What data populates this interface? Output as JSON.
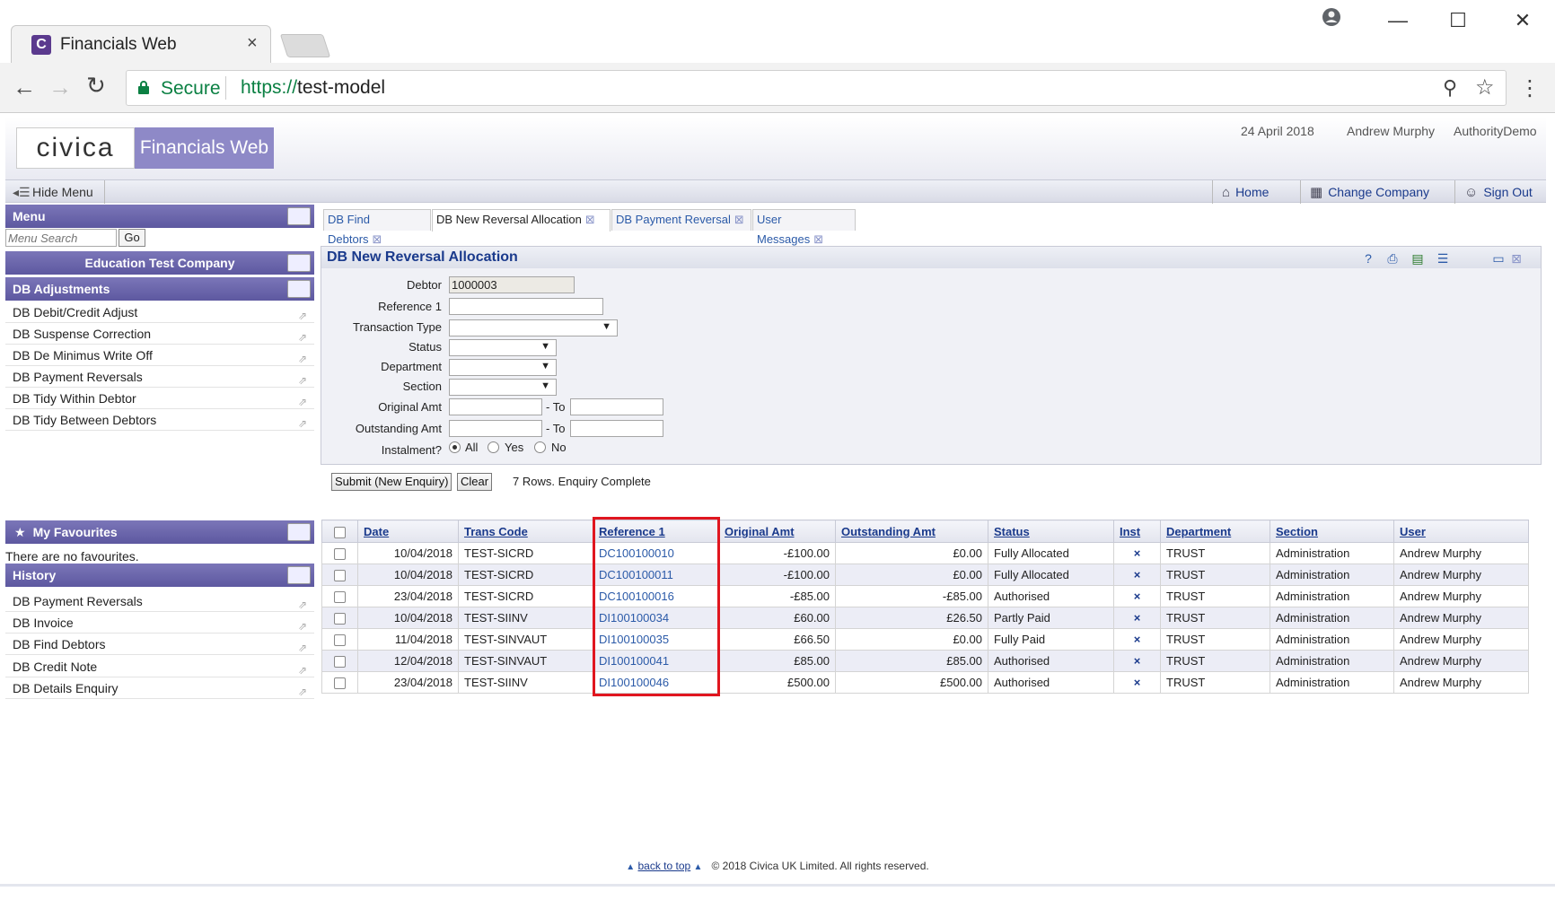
{
  "browser": {
    "tab_title": "Financials Web",
    "tab_close": "×",
    "favicon_letter": "C",
    "secure_label": "Secure",
    "url_scheme": "https://",
    "url_host": "test-model"
  },
  "header": {
    "logo_text": "civica",
    "product_name": "Financials Web",
    "date": "24 April 2018",
    "user": "Andrew Murphy",
    "company": "AuthorityDemo"
  },
  "toolbar": {
    "hide_menu": "Hide Menu",
    "home": "Home",
    "change_company": "Change Company",
    "sign_out": "Sign Out"
  },
  "sidebar": {
    "menu_title": "Menu",
    "search_placeholder": "Menu Search",
    "go_label": "Go",
    "company_title": "Education Test Company",
    "section_title": "DB Adjustments",
    "items": [
      {
        "label": "DB Debit/Credit Adjust"
      },
      {
        "label": "DB Suspense Correction"
      },
      {
        "label": "DB De Minimus Write Off"
      },
      {
        "label": "DB Payment Reversals"
      },
      {
        "label": "DB Tidy Within Debtor"
      },
      {
        "label": "DB Tidy Between Debtors"
      }
    ],
    "favourites_title": "My Favourites",
    "no_favourites": "There are no favourites.",
    "history_title": "History",
    "history": [
      {
        "label": "DB Payment Reversals"
      },
      {
        "label": "DB Invoice"
      },
      {
        "label": "DB Find Debtors"
      },
      {
        "label": "DB Credit Note"
      },
      {
        "label": "DB Details Enquiry"
      }
    ]
  },
  "tabs": [
    {
      "label": "DB Find Debtors"
    },
    {
      "label": "DB New Reversal Allocation"
    },
    {
      "label": "DB Payment Reversal"
    },
    {
      "label": "User Messages"
    }
  ],
  "panel": {
    "title": "DB New Reversal Allocation",
    "fields": {
      "debtor_label": "Debtor",
      "debtor_value": "1000003",
      "reference_label": "Reference 1",
      "transaction_type_label": "Transaction Type",
      "status_label": "Status",
      "department_label": "Department",
      "section_label": "Section",
      "original_amt_label": "Original Amt",
      "outstanding_amt_label": "Outstanding Amt",
      "to_label": "- To",
      "instalment_label": "Instalment?",
      "radio_all": "All",
      "radio_yes": "Yes",
      "radio_no": "No"
    }
  },
  "actions": {
    "submit": "Submit (New Enquiry)",
    "clear": "Clear",
    "status": "7 Rows. Enquiry Complete"
  },
  "grid": {
    "columns": [
      "Date",
      "Trans Code",
      "Reference 1",
      "Original Amt",
      "Outstanding Amt",
      "Status",
      "Inst",
      "Department",
      "Section",
      "User"
    ],
    "rows": [
      {
        "date": "10/04/2018",
        "trans_code": "TEST-SICRD",
        "reference": "DC100100010",
        "original": "-£100.00",
        "outstanding": "£0.00",
        "status": "Fully Allocated",
        "inst": "×",
        "department": "TRUST",
        "section": "Administration",
        "user": "Andrew Murphy"
      },
      {
        "date": "10/04/2018",
        "trans_code": "TEST-SICRD",
        "reference": "DC100100011",
        "original": "-£100.00",
        "outstanding": "£0.00",
        "status": "Fully Allocated",
        "inst": "×",
        "department": "TRUST",
        "section": "Administration",
        "user": "Andrew Murphy"
      },
      {
        "date": "23/04/2018",
        "trans_code": "TEST-SICRD",
        "reference": "DC100100016",
        "original": "-£85.00",
        "outstanding": "-£85.00",
        "status": "Authorised",
        "inst": "×",
        "department": "TRUST",
        "section": "Administration",
        "user": "Andrew Murphy"
      },
      {
        "date": "10/04/2018",
        "trans_code": "TEST-SIINV",
        "reference": "DI100100034",
        "original": "£60.00",
        "outstanding": "£26.50",
        "status": "Partly Paid",
        "inst": "×",
        "department": "TRUST",
        "section": "Administration",
        "user": "Andrew Murphy"
      },
      {
        "date": "11/04/2018",
        "trans_code": "TEST-SINVAUT",
        "reference": "DI100100035",
        "original": "£66.50",
        "outstanding": "£0.00",
        "status": "Fully Paid",
        "inst": "×",
        "department": "TRUST",
        "section": "Administration",
        "user": "Andrew Murphy"
      },
      {
        "date": "12/04/2018",
        "trans_code": "TEST-SINVAUT",
        "reference": "DI100100041",
        "original": "£85.00",
        "outstanding": "£85.00",
        "status": "Authorised",
        "inst": "×",
        "department": "TRUST",
        "section": "Administration",
        "user": "Andrew Murphy"
      },
      {
        "date": "23/04/2018",
        "trans_code": "TEST-SIINV",
        "reference": "DI100100046",
        "original": "£500.00",
        "outstanding": "£500.00",
        "status": "Authorised",
        "inst": "×",
        "department": "TRUST",
        "section": "Administration",
        "user": "Andrew Murphy"
      }
    ]
  },
  "footer": {
    "back_to_top": "back to top",
    "copyright": "© 2018 Civica UK Limited. All rights reserved."
  },
  "icons": {
    "lock": "lock-icon",
    "home": "home-icon",
    "change_company": "building-icon",
    "sign_out": "sign-out-icon",
    "favourites": "star-icon",
    "highlight_color": "#e0161f",
    "accent": "#5d58a0"
  }
}
